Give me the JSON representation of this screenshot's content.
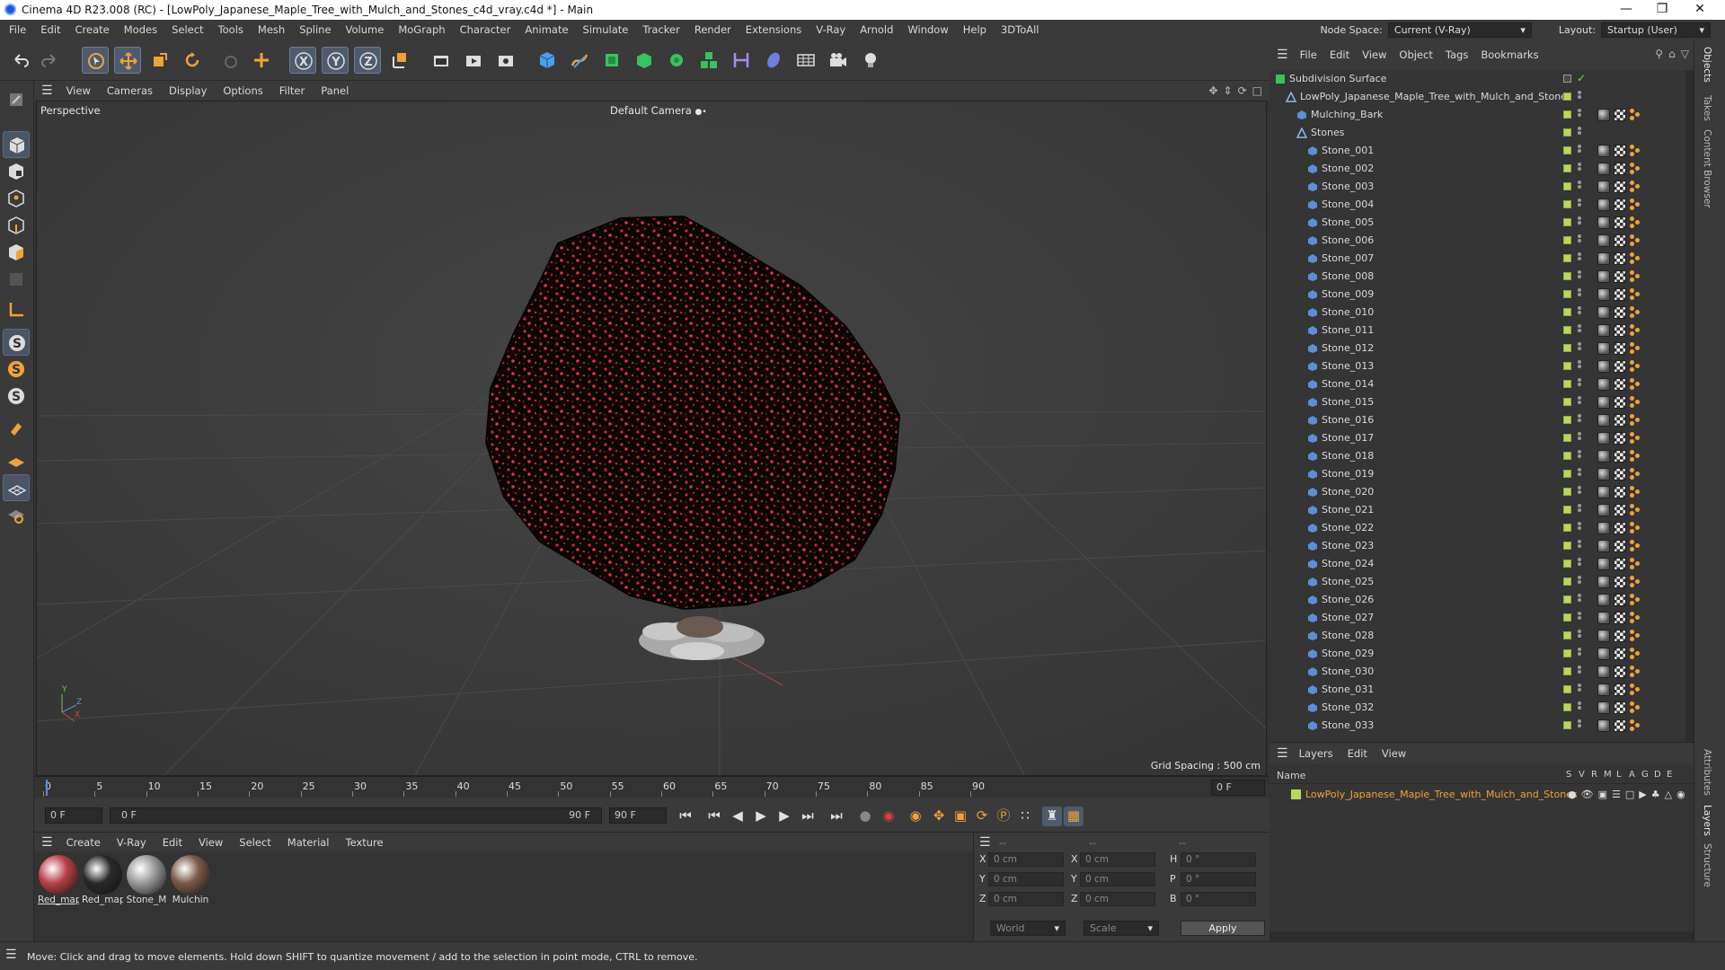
{
  "window": {
    "title": "Cinema 4D R23.008 (RC) - [LowPoly_Japanese_Maple_Tree_with_Mulch_and_Stones_c4d_vray.c4d *] - Main",
    "controls": [
      "—",
      "❐",
      "✕"
    ]
  },
  "menu": [
    "File",
    "Edit",
    "Create",
    "Modes",
    "Select",
    "Tools",
    "Mesh",
    "Spline",
    "Volume",
    "MoGraph",
    "Character",
    "Animate",
    "Simulate",
    "Tracker",
    "Render",
    "Extensions",
    "V-Ray",
    "Arnold",
    "Window",
    "Help",
    "3DToAll"
  ],
  "node_space": {
    "label": "Node Space:",
    "value": "Current (V-Ray)"
  },
  "layout": {
    "label": "Layout:",
    "value": "Startup (User)"
  },
  "viewport": {
    "menu": [
      "View",
      "Cameras",
      "Display",
      "Options",
      "Filter",
      "Panel"
    ],
    "view_name": "Perspective",
    "camera": "Default Camera",
    "grid_spacing": "Grid Spacing : 500 cm",
    "axis": {
      "y": "Y",
      "z": "Z",
      "x": "X"
    }
  },
  "timeline": {
    "ticks": [
      "0",
      "5",
      "10",
      "15",
      "20",
      "25",
      "30",
      "35",
      "40",
      "45",
      "50",
      "55",
      "60",
      "65",
      "70",
      "75",
      "80",
      "85",
      "90"
    ],
    "current_frame": "0 F",
    "start_field": "0 F",
    "range_start": "0 F",
    "range_end": "90 F",
    "end_field": "90 F"
  },
  "materials": {
    "menu": [
      "Create",
      "V-Ray",
      "Edit",
      "View",
      "Select",
      "Material",
      "Texture"
    ],
    "items": [
      {
        "label": "Red_map",
        "color": "#b8414a"
      },
      {
        "label": "Red_map",
        "color": "#2a2a2a"
      },
      {
        "label": "Stone_M",
        "color": "#9a9a9a"
      },
      {
        "label": "Mulchin",
        "color": "#7a5a4a"
      }
    ]
  },
  "coords": {
    "head": [
      "--",
      "--",
      "--"
    ],
    "rows": [
      {
        "a": "X",
        "av": "0 cm",
        "b": "X",
        "bv": "0 cm",
        "c": "H",
        "cv": "0 °"
      },
      {
        "a": "Y",
        "av": "0 cm",
        "b": "Y",
        "bv": "0 cm",
        "c": "P",
        "cv": "0 °"
      },
      {
        "a": "Z",
        "av": "0 cm",
        "b": "Z",
        "bv": "0 cm",
        "c": "B",
        "cv": "0 °"
      }
    ],
    "mode1": "World",
    "mode2": "Scale",
    "apply": "Apply"
  },
  "objects": {
    "menu": [
      "File",
      "Edit",
      "View",
      "Object",
      "Tags",
      "Bookmarks"
    ],
    "subdivision": "Subdivision Surface",
    "root": "LowPoly_Japanese_Maple_Tree_with_Mulch_and_Stones",
    "mulching": "Mulching_Bark",
    "stones": "Stones",
    "stone_items": [
      "Stone_001",
      "Stone_002",
      "Stone_003",
      "Stone_004",
      "Stone_005",
      "Stone_006",
      "Stone_007",
      "Stone_008",
      "Stone_009",
      "Stone_010",
      "Stone_011",
      "Stone_012",
      "Stone_013",
      "Stone_014",
      "Stone_015",
      "Stone_016",
      "Stone_017",
      "Stone_018",
      "Stone_019",
      "Stone_020",
      "Stone_021",
      "Stone_022",
      "Stone_023",
      "Stone_024",
      "Stone_025",
      "Stone_026",
      "Stone_027",
      "Stone_028",
      "Stone_029",
      "Stone_030",
      "Stone_031",
      "Stone_032",
      "Stone_033"
    ]
  },
  "layers": {
    "menu": [
      "Layers",
      "Edit",
      "View"
    ],
    "col_name": "Name",
    "cols": [
      "S",
      "V",
      "R",
      "M",
      "L",
      "A",
      "G",
      "D",
      "E"
    ],
    "item": "LowPoly_Japanese_Maple_Tree_with_Mulch_and_Stones"
  },
  "side_tabs": [
    "Objects",
    "Takes",
    "Content Browser",
    "Attributes",
    "Layers",
    "Structure"
  ],
  "status": "Move: Click and drag to move elements. Hold down SHIFT to quantize movement / add to the selection in point mode, CTRL to remove."
}
